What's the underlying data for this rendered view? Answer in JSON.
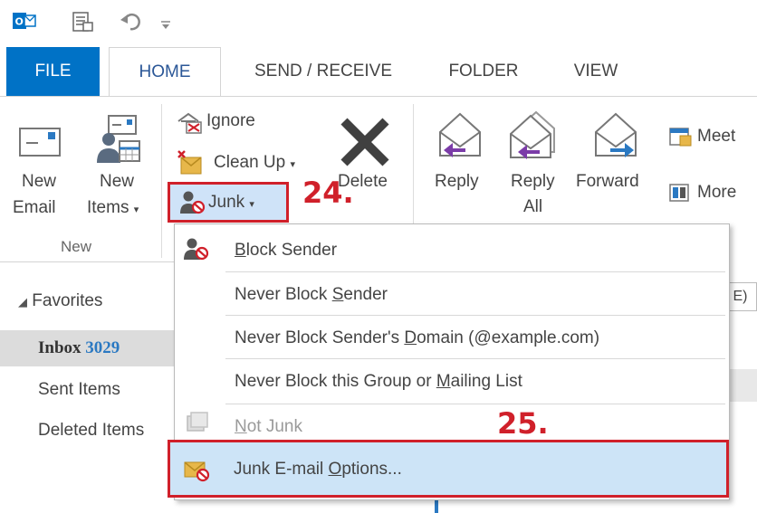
{
  "ribbon_tabs": [
    "FILE",
    "HOME",
    "SEND / RECEIVE",
    "FOLDER",
    "VIEW"
  ],
  "new_group": {
    "new_email": [
      "New",
      "Email"
    ],
    "new_items": [
      "New",
      "Items"
    ],
    "group_label": "New"
  },
  "delete_group": {
    "ignore": "Ignore",
    "clean_up": "Clean Up",
    "junk": "Junk",
    "delete": "Delete"
  },
  "respond_group": {
    "reply": "Reply",
    "reply_all": [
      "Reply",
      "All"
    ],
    "forward": "Forward",
    "meet": "Meet",
    "more": "More"
  },
  "annotations": {
    "step_24": "24.",
    "step_25": "25."
  },
  "junk_menu": {
    "block_sender": {
      "pre": "",
      "key": "B",
      "post": "lock Sender"
    },
    "never_block_sender": {
      "pre": "Never Block ",
      "key": "S",
      "post": "ender"
    },
    "never_block_domain": {
      "pre": "Never Block Sender's ",
      "key": "D",
      "post": "omain (@example.com)"
    },
    "never_block_group": {
      "pre": "Never Block this Group or ",
      "key": "M",
      "post": "ailing List"
    },
    "not_junk": {
      "pre": "",
      "key": "N",
      "post": "ot Junk"
    },
    "junk_options": {
      "pre": "Junk E-mail ",
      "key": "O",
      "post": "ptions..."
    }
  },
  "nav": {
    "favorites": "Favorites",
    "inbox": "Inbox",
    "inbox_count": "3029",
    "sent": "Sent Items",
    "deleted": "Deleted Items"
  },
  "colors": {
    "file_tab": "#0072c6",
    "highlight": "#d0202a",
    "selection": "#cde4f7"
  }
}
